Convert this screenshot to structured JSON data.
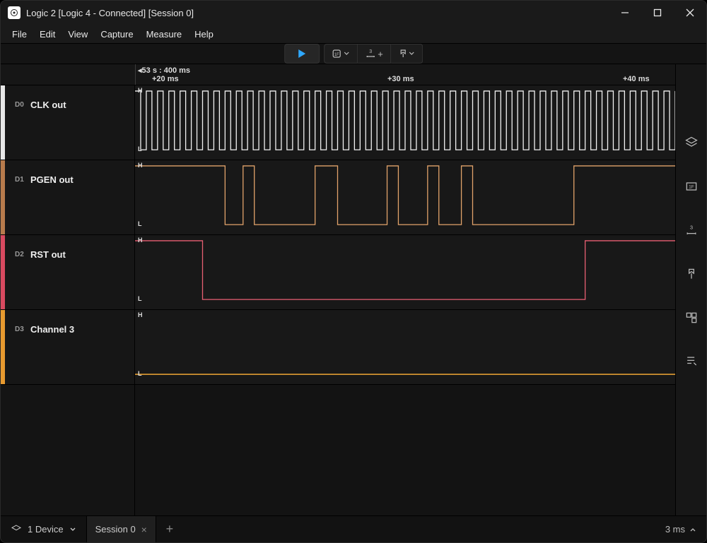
{
  "window": {
    "title": "Logic 2 [Logic 4 - Connected] [Session 0]"
  },
  "menu": {
    "items": [
      "File",
      "Edit",
      "View",
      "Capture",
      "Measure",
      "Help"
    ]
  },
  "timeline": {
    "anchor": "53 s : 400 ms",
    "ticks": [
      "+20 ms",
      "+30 ms",
      "+40 ms"
    ]
  },
  "channels": [
    {
      "idx": "D0",
      "name": "CLK out",
      "color": "#f2f2f2"
    },
    {
      "idx": "D1",
      "name": "PGEN out",
      "color": "#e2a36a"
    },
    {
      "idx": "D2",
      "name": "RST out",
      "color": "#e85f72"
    },
    {
      "idx": "D3",
      "name": "Channel 3",
      "color": "#f0a634"
    }
  ],
  "bottom": {
    "device": "1 Device",
    "session": "Session 0",
    "zoom": "3 ms"
  },
  "chart_data": {
    "type": "digital-timing",
    "time_window_ms": [
      18,
      42
    ],
    "anchor_time": "53 s 400 ms",
    "grid_lines_ms": [
      20,
      30,
      40
    ],
    "channels": [
      {
        "id": "D0",
        "name": "CLK out",
        "waveform": "periodic-clock",
        "period_ms": 0.5,
        "duty_cycle": 0.5,
        "level_at_start": "H"
      },
      {
        "id": "D1",
        "name": "PGEN out",
        "waveform": "pulse-train",
        "initial_level": "H",
        "transitions_ms": [
          22.0,
          22.8,
          23.3,
          26.0,
          27.0,
          29.2,
          29.7,
          31.0,
          31.5,
          32.5,
          33.0,
          37.5
        ],
        "note": "High intervals after initial high->low at 22.0: [22.8-23.3],[26.0-27.0],[29.2-29.7],[31.0-31.5],[32.5-33.0],[37.5-end]"
      },
      {
        "id": "D2",
        "name": "RST out",
        "waveform": "single-pulse-low",
        "initial_level": "H",
        "fall_ms": 21.0,
        "rise_ms": 38.0
      },
      {
        "id": "D3",
        "name": "Channel 3",
        "waveform": "constant",
        "level": "L"
      }
    ]
  }
}
